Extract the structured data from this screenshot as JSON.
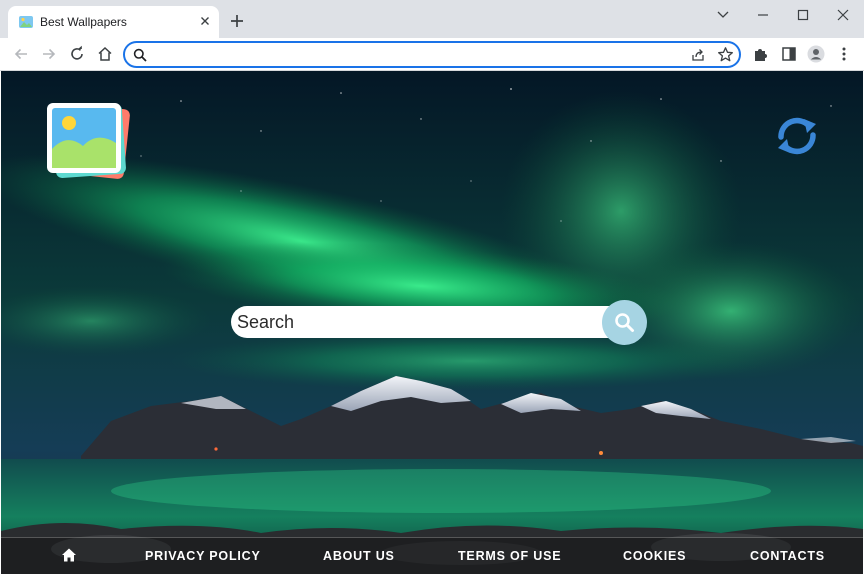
{
  "browser": {
    "tab": {
      "title": "Best Wallpapers",
      "favicon": "image-gallery-icon",
      "close_icon": "close-icon"
    },
    "new_tab_icon": "plus-icon",
    "window_controls": [
      "chevron-down-icon",
      "minimize-icon",
      "maximize-icon",
      "close-icon"
    ],
    "nav_icons": [
      "back-arrow-icon",
      "forward-arrow-icon",
      "reload-icon",
      "home-icon"
    ],
    "omnibox": {
      "value": "",
      "placeholder": "",
      "search_icon": "search-icon",
      "share_icon": "share-icon",
      "bookmark_icon": "star-icon"
    },
    "toolbar_icons": [
      "extensions-puzzle-icon",
      "side-panel-icon",
      "profile-avatar-icon",
      "kebab-menu-icon"
    ]
  },
  "page": {
    "logo": "wallpaper-picture-logo",
    "refresh_icon": "refresh-arrows-icon",
    "search": {
      "placeholder": "Search",
      "button_icon": "magnifier-icon"
    },
    "footer": {
      "home_icon": "home-icon",
      "links": [
        "PRIVACY POLICY",
        "ABOUT US",
        "TERMS OF USE",
        "COOKIES",
        "CONTACTS"
      ]
    }
  },
  "colors": {
    "tab_bar": "#dee1e6",
    "omnibox_focus": "#1a73e8",
    "aurora_green": "#1fd17a",
    "search_button": "#a6d4e3",
    "refresh_icon": "#3a86d6"
  }
}
